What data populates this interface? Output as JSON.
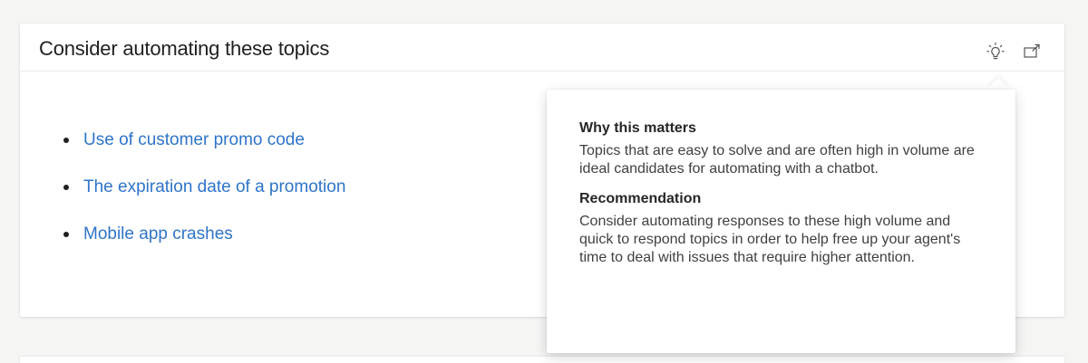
{
  "card": {
    "title": "Consider automating these topics",
    "actions": [
      {
        "icon": "lightbulb-icon"
      },
      {
        "icon": "popout-icon"
      }
    ],
    "topics": [
      {
        "label": "Use of customer promo code"
      },
      {
        "label": "The expiration date of a promotion"
      },
      {
        "label": "Mobile app crashes"
      }
    ]
  },
  "tooltip": {
    "why_heading": "Why this matters",
    "why_text": "Topics that are easy to solve and are often high in volume are ideal candidates for automating with a chatbot.",
    "rec_heading": "Recommendation",
    "rec_text": "Consider automating responses to these high volume and quick to respond topics in order to help free up your agent's time to deal with issues that require higher attention."
  },
  "colors": {
    "link": "#2f74c9",
    "background": "#f5f5f4",
    "card": "#ffffff"
  }
}
